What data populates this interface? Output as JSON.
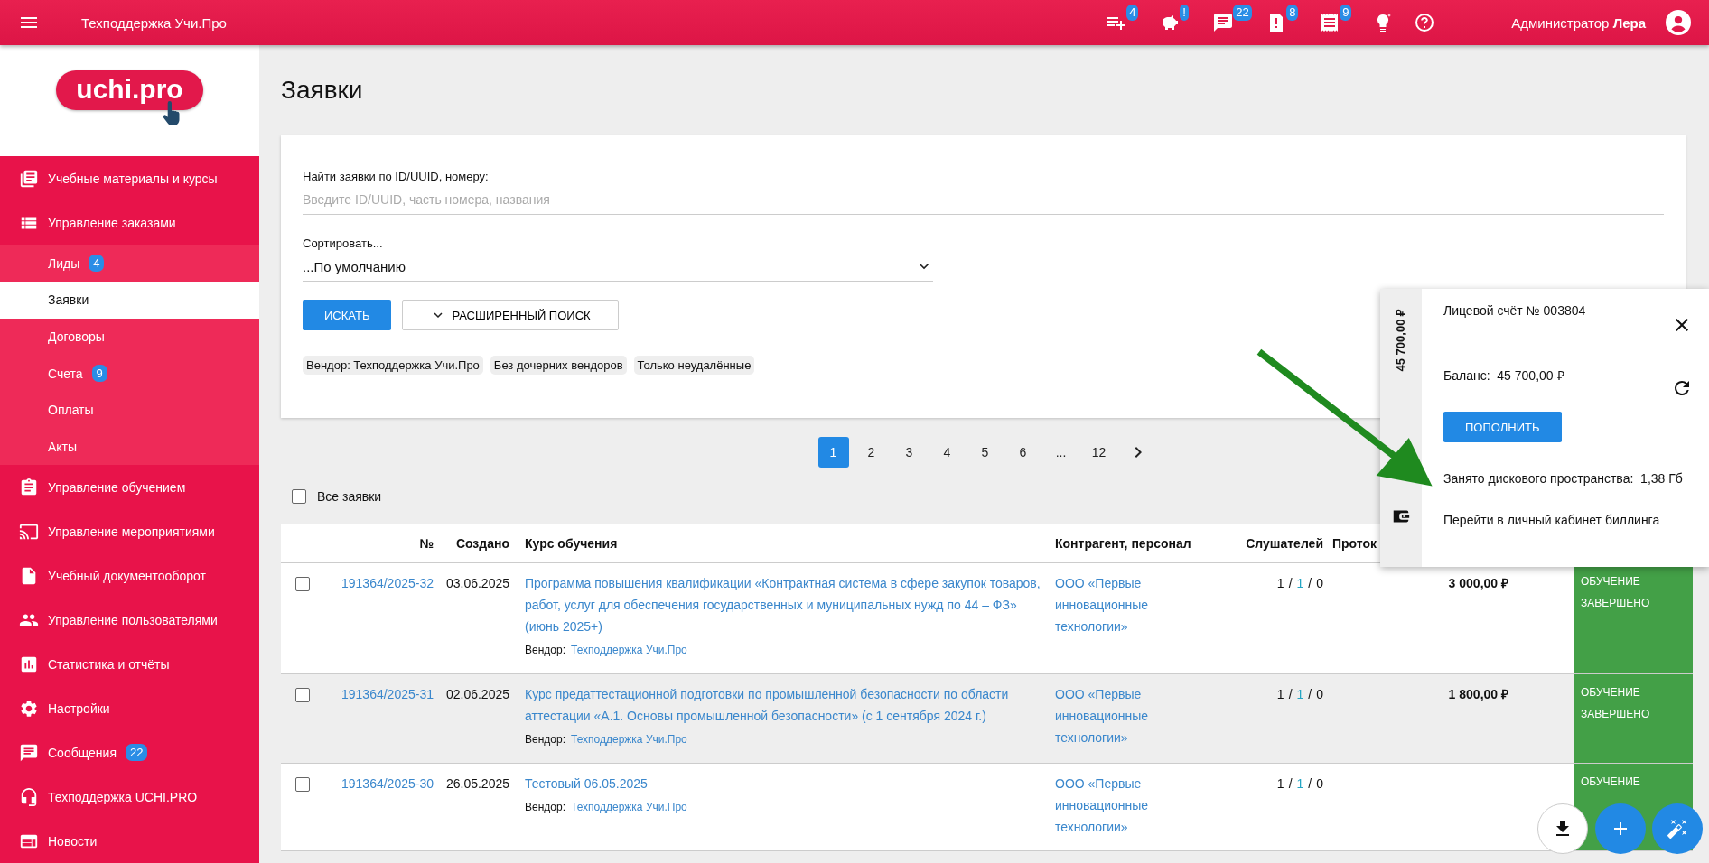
{
  "topbar": {
    "title": "Техподдержка Учи.Про",
    "notifications": [
      {
        "badge": "4"
      },
      {
        "badge": "!"
      },
      {
        "badge": "22"
      },
      {
        "badge": "8"
      },
      {
        "badge": "9"
      }
    ],
    "user": "Администратор **Лера**"
  },
  "sidebar": {
    "logo": "uchi.pro",
    "items": [
      {
        "label": "Учебные материалы и курсы",
        "selected": false
      },
      {
        "label": "Управление заказами",
        "selected": false,
        "expanded": true,
        "children": [
          {
            "label": "Лиды",
            "badge": "4",
            "selected": false
          },
          {
            "label": "Заявки",
            "selected": true
          },
          {
            "label": "Договоры",
            "selected": false
          },
          {
            "label": "Счета",
            "badge": "9",
            "selected": false
          },
          {
            "label": "Оплаты",
            "selected": false
          },
          {
            "label": "Акты",
            "selected": false
          }
        ]
      },
      {
        "label": "Управление обучением",
        "selected": false
      },
      {
        "label": "Управление мероприятиями",
        "selected": false
      },
      {
        "label": "Учебный документооборот",
        "selected": false
      },
      {
        "label": "Управление пользователями",
        "selected": false
      },
      {
        "label": "Статистика и отчёты",
        "selected": false
      },
      {
        "label": "Настройки",
        "selected": false
      },
      {
        "label": "Сообщения",
        "badge": "22",
        "selected": false
      },
      {
        "label": "Техподдержка UCHI.PRO",
        "selected": false
      },
      {
        "label": "Новости",
        "selected": false
      }
    ]
  },
  "page_title": "Заявки",
  "search": {
    "label": "Найти заявки по ID/UUID, номеру:",
    "placeholder": "Введите ID/UUID, часть номера, названия",
    "sort_label": "Сортировать...",
    "sort_value": "...По умолчанию",
    "search_button": "ИСКАТЬ",
    "advanced_button": "РАСШИРЕННЫЙ ПОИСК",
    "filters": [
      "Вендор: Техподдержка Учи.Про",
      "Без дочерних вендоров",
      "Только неудалённые"
    ]
  },
  "pagination": [
    {
      "label": "1",
      "selected": true
    },
    {
      "label": "2",
      "selected": false
    },
    {
      "label": "3",
      "selected": false
    },
    {
      "label": "4",
      "selected": false
    },
    {
      "label": "5",
      "selected": false
    },
    {
      "label": "6",
      "selected": false
    },
    {
      "label": "...",
      "selected": false
    },
    {
      "label": "12",
      "selected": false
    }
  ],
  "select_all": {
    "label": "Все заявки",
    "checked": false
  },
  "table": {
    "columns": [
      "№",
      "Создано",
      "Курс обучения",
      "Контрагент, персонал",
      "Слушателей",
      "Проток"
    ],
    "rows": [
      {
        "checked": false,
        "highlighted": false,
        "number": "191364/2025-32",
        "created": "03.06.2025",
        "course": "Программа повышения квалификации «Контрактная система в сфере закупок товаров, работ, услуг для обеспечения государственных и муниципальных нужд по 44 – ФЗ» (июнь 2025+)",
        "vendor_label": "Вендор:",
        "vendor": "Техподдержка Учи.Про",
        "counterparty": "ООО «Первые инновационные технологии»",
        "listeners": [
          "1",
          "/",
          "1",
          "/",
          "0"
        ],
        "amount": "3 000,00 ₽",
        "status": {
          "kind": "done",
          "lines": [
            "ОБУЧЕНИЕ",
            "ЗАВЕРШЕНО"
          ]
        }
      },
      {
        "checked": false,
        "highlighted": true,
        "number": "191364/2025-31",
        "created": "02.06.2025",
        "course": "Курс предаттестационной подготовки по промышленной безопасности по области аттестации «А.1. Основы промышленной безопасности» (с 1 сентября 2024 г.)",
        "vendor_label": "Вендор:",
        "vendor": "Техподдержка Учи.Про",
        "counterparty": "ООО «Первые инновационные технологии»",
        "listeners": [
          "1",
          "/",
          "1",
          "/",
          "0"
        ],
        "amount": "1 800,00 ₽",
        "status": {
          "kind": "done",
          "lines": [
            "ОБУЧЕНИЕ",
            "ЗАВЕРШЕНО"
          ]
        }
      },
      {
        "checked": false,
        "highlighted": false,
        "number": "191364/2025-30",
        "created": "26.05.2025",
        "course": "Тестовый 06.05.2025",
        "vendor_label": "Вендор:",
        "vendor": "Техподдержка Учи.Про",
        "counterparty": "ООО «Первые инновационные технологии»",
        "listeners": [
          "1",
          "/",
          "1",
          "/",
          "0"
        ],
        "status": {
          "kind": "done",
          "lines": [
            "ОБУЧЕНИЕ"
          ]
        }
      }
    ]
  },
  "billing_panel": {
    "side_amount": "45 700,00 ₽",
    "account": "Лицевой счёт № 003804",
    "balance_label": "Баланс:",
    "balance": "45 700,00 ₽",
    "topup_button": "ПОПОЛНИТЬ",
    "disk_label": "Занято дискового пространства:",
    "disk": "1,38 Гб",
    "billing_link": "Перейти в личный кабинет биллинга"
  }
}
